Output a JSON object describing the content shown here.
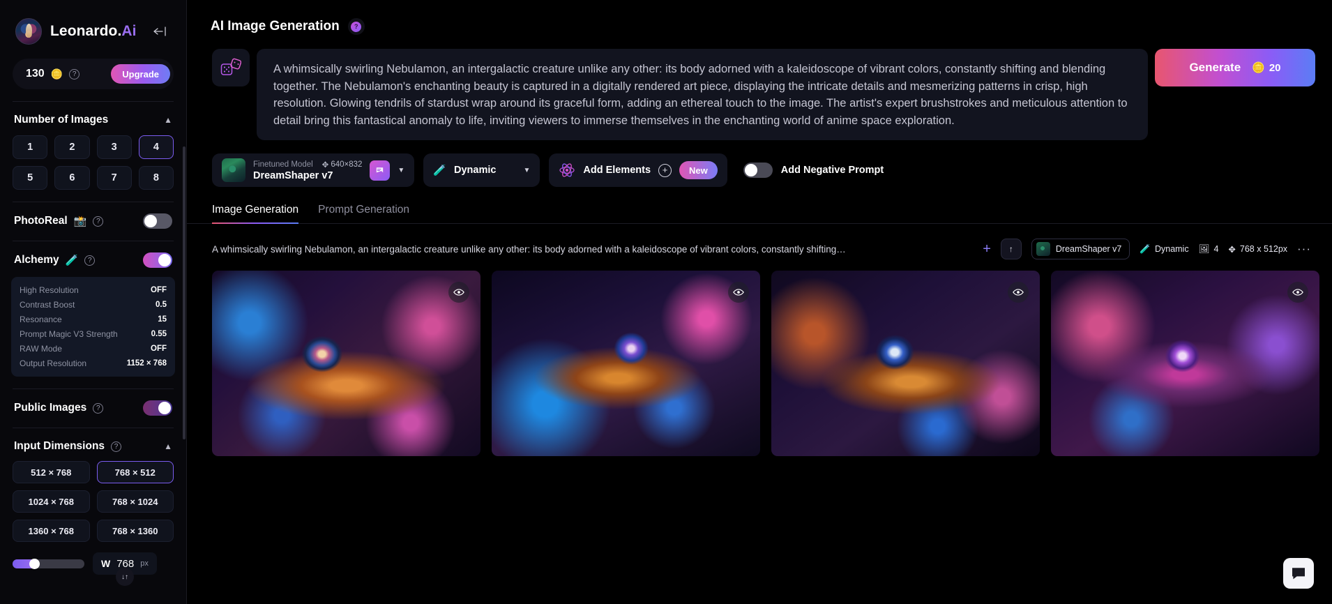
{
  "sidebar": {
    "brand": {
      "name_main": "Leonardo.",
      "name_accent": "Ai",
      "logo_icon": "leonardo-avatar-logo"
    },
    "collapse_icon": "collapse-left-icon",
    "credits": {
      "count": "130",
      "coin_icon": "coins-icon",
      "help_icon": "question-icon",
      "upgrade_label": "Upgrade"
    },
    "number_of_images": {
      "title": "Number of Images",
      "chevron_icon": "chevron-up-icon",
      "options": [
        "1",
        "2",
        "3",
        "4",
        "5",
        "6",
        "7",
        "8"
      ],
      "selected": "4"
    },
    "photoreal": {
      "label": "PhotoReal",
      "emoji": "📸",
      "help_icon": "question-icon",
      "enabled": false
    },
    "alchemy": {
      "label": "Alchemy",
      "emoji": "🧪",
      "help_icon": "question-icon",
      "enabled": true,
      "settings": [
        {
          "label": "High Resolution",
          "value": "OFF"
        },
        {
          "label": "Contrast Boost",
          "value": "0.5"
        },
        {
          "label": "Resonance",
          "value": "15"
        },
        {
          "label": "Prompt Magic V3 Strength",
          "value": "0.55"
        },
        {
          "label": "RAW Mode",
          "value": "OFF"
        },
        {
          "label": "Output Resolution",
          "value": "1152 × 768"
        }
      ]
    },
    "public_images": {
      "label": "Public Images",
      "help_icon": "question-icon",
      "enabled": true
    },
    "input_dimensions": {
      "title": "Input Dimensions",
      "help_icon": "question-icon",
      "chevron_icon": "chevron-up-icon",
      "presets": [
        "512 × 768",
        "768 × 512",
        "1024 × 768",
        "768 × 1024",
        "1360 × 768",
        "768 × 1360"
      ],
      "selected": "768 × 512",
      "width_field": {
        "axis_label": "W",
        "value": "768",
        "unit": "px",
        "swap_icon": "swap-vertical-icon"
      }
    }
  },
  "main": {
    "header": {
      "title": "AI Image Generation",
      "help_icon": "question-badge-icon"
    },
    "prompt": {
      "dice_icon": "dice-icon",
      "text": "A whimsically swirling Nebulamon, an intergalactic creature unlike any other: its body adorned with a kaleidoscope of vibrant colors, constantly shifting and blending together. The Nebulamon's enchanting beauty is captured in a digitally rendered art piece, displaying the intricate details and mesmerizing patterns in crisp, high resolution. Glowing tendrils of stardust wrap around its graceful form, adding an ethereal touch to the image. The artist's expert brushstrokes and meticulous attention to detail bring this fantastical anomaly to life, inviting viewers to immerse themselves in the enchanting world of anime space exploration."
    },
    "generate": {
      "label": "Generate",
      "cost": "20",
      "coin_icon": "coins-icon"
    },
    "controls": {
      "model": {
        "caption": "Finetuned Model",
        "dimensions": "640×832",
        "move_icon": "move-arrows-icon",
        "name": "DreamShaper v7",
        "badge_icon": "model-card-icon",
        "caret_icon": "chevron-down-icon",
        "thumb_icon": "model-thumbnail"
      },
      "preset": {
        "emoji": "🧪",
        "label": "Dynamic",
        "caret_icon": "chevron-down-icon"
      },
      "elements": {
        "icon": "atom-icon",
        "label": "Add Elements",
        "plus_icon": "plus-circle-icon",
        "badge": "New"
      },
      "negative_prompt": {
        "label": "Add Negative Prompt",
        "enabled": false
      }
    },
    "tabs": [
      {
        "label": "Image Generation",
        "active": true
      },
      {
        "label": "Prompt Generation",
        "active": false
      }
    ],
    "result": {
      "prompt": "A whimsically swirling Nebulamon, an intergalactic creature unlike any other: its body adorned with a kaleidoscope of vibrant colors, constantly shifting…",
      "add_icon": "plus-icon",
      "upload_icon": "arrow-up-icon",
      "model_name": "DreamShaper v7",
      "model_thumb_icon": "model-thumbnail",
      "preset_emoji": "🧪",
      "preset_label": "Dynamic",
      "image_count_icon": "images-icon",
      "image_count": "4",
      "size_icon": "move-arrows-icon",
      "size": "768 x 512px",
      "more_icon": "more-horizontal-icon",
      "images": [
        {
          "alt": "generated-image-1",
          "eye_icon": "eye-icon"
        },
        {
          "alt": "generated-image-2",
          "eye_icon": "eye-icon"
        },
        {
          "alt": "generated-image-3",
          "eye_icon": "eye-icon"
        },
        {
          "alt": "generated-image-4",
          "eye_icon": "eye-icon"
        }
      ]
    },
    "chat_widget": {
      "icon": "chat-bubble-icon"
    }
  },
  "colors": {
    "accent_purple": "#8b5cf6",
    "accent_pink": "#e056b4",
    "accent_blue": "#5b7df5",
    "panel": "#12141f",
    "background": "#000000"
  }
}
